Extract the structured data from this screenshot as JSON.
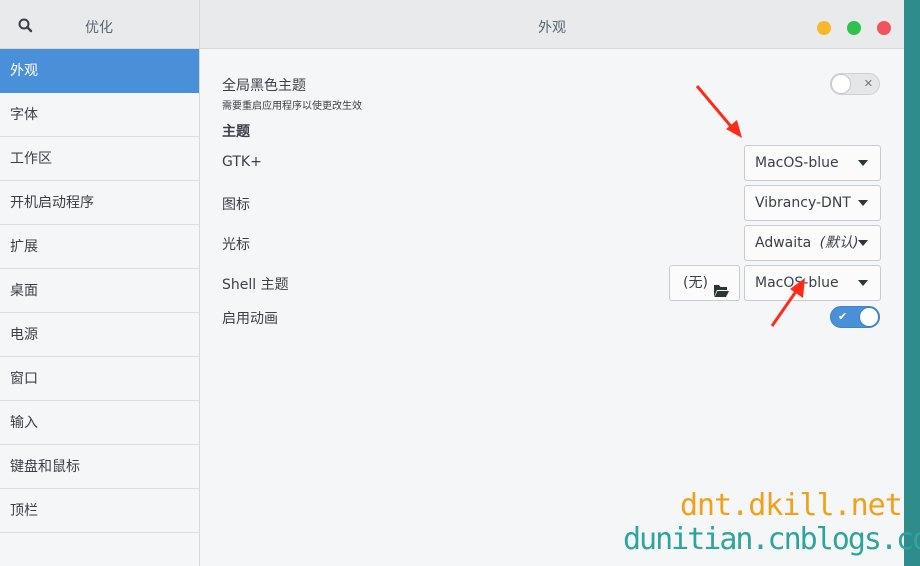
{
  "app": {
    "title": "优化",
    "page_title": "外观"
  },
  "sidebar": {
    "items": [
      {
        "label": "外观",
        "active": true
      },
      {
        "label": "字体"
      },
      {
        "label": "工作区"
      },
      {
        "label": "开机启动程序"
      },
      {
        "label": "扩展"
      },
      {
        "label": "桌面"
      },
      {
        "label": "电源"
      },
      {
        "label": "窗口"
      },
      {
        "label": "输入"
      },
      {
        "label": "键盘和鼠标"
      },
      {
        "label": "顶栏"
      }
    ]
  },
  "appearance": {
    "dark_theme": {
      "label": "全局黑色主题",
      "note": "需要重启应用程序以使更改生效",
      "state": "off",
      "mark": "✕"
    },
    "themes_heading": "主题",
    "gtk": {
      "label": "GTK+",
      "value": "MacOS-blue"
    },
    "icons": {
      "label": "图标",
      "value": "Vibrancy-DNT"
    },
    "cursor": {
      "label": "光标",
      "value": "Adwaita",
      "default_tag": "(默认)"
    },
    "shell": {
      "label": "Shell 主题",
      "none_label": "(无)",
      "value": "MacOS-blue"
    },
    "animations": {
      "label": "启用动画",
      "state": "on",
      "mark": "✔"
    }
  },
  "watermarks": [
    "dnt.dkill.net",
    "dunitian.cnblogs.com"
  ],
  "colors": {
    "accent": "#4a90d9",
    "arrow": "#ff2a1a",
    "watermark1": "#f0a11c",
    "watermark2": "#2ea59a"
  }
}
